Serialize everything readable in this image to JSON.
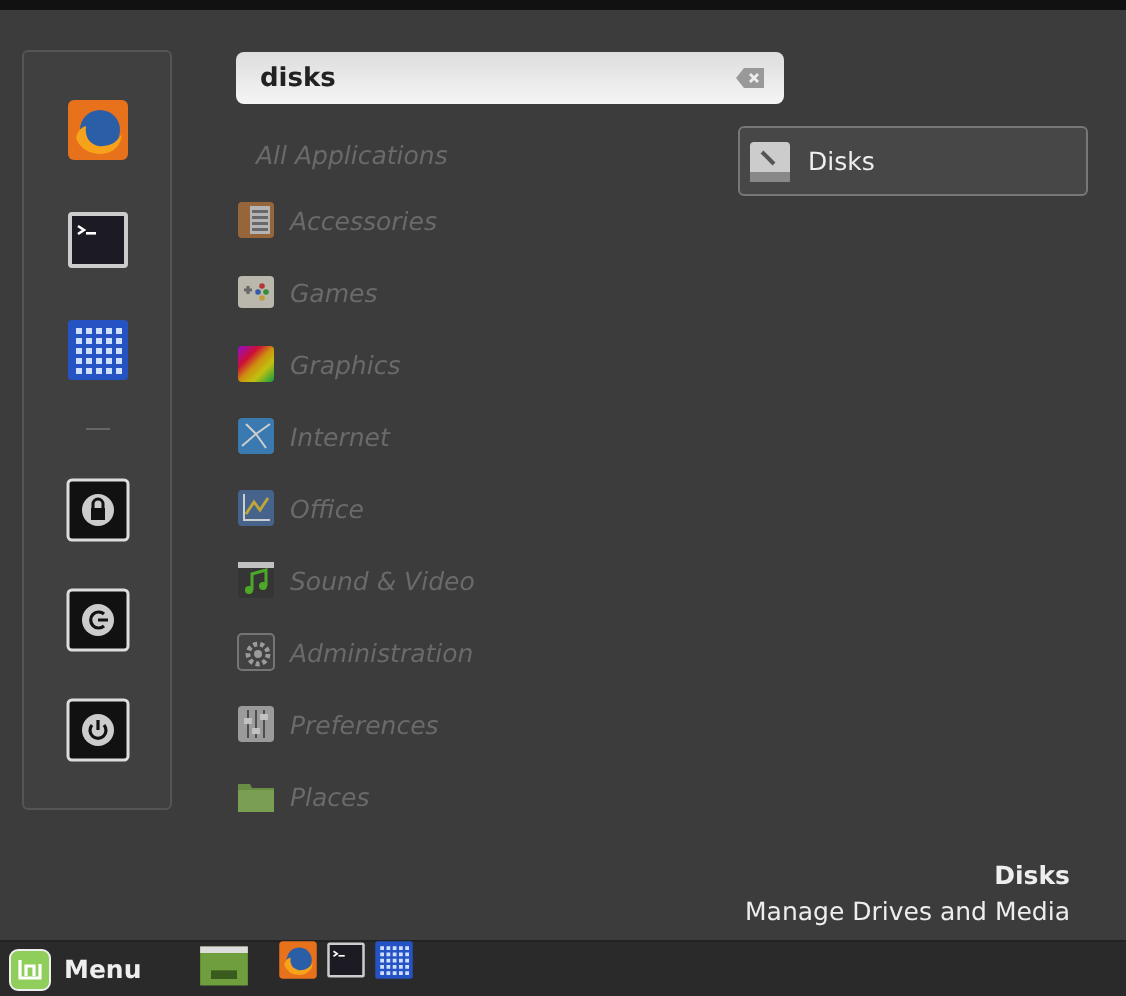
{
  "favorites": [
    {
      "kind": "firefox"
    },
    {
      "kind": "terminal"
    },
    {
      "kind": "grid"
    },
    {
      "kind": "separator"
    },
    {
      "kind": "lock"
    },
    {
      "kind": "logout"
    },
    {
      "kind": "power"
    }
  ],
  "search": {
    "value": "disks"
  },
  "categories": [
    {
      "label": "All Applications",
      "kind": "none",
      "disabled": true
    },
    {
      "label": "Accessories",
      "kind": "accessories",
      "disabled": true
    },
    {
      "label": "Games",
      "kind": "games",
      "disabled": true
    },
    {
      "label": "Graphics",
      "kind": "graphics",
      "disabled": true
    },
    {
      "label": "Internet",
      "kind": "internet",
      "disabled": true
    },
    {
      "label": "Office",
      "kind": "office",
      "disabled": true
    },
    {
      "label": "Sound & Video",
      "kind": "sound",
      "disabled": true
    },
    {
      "label": "Administration",
      "kind": "admin",
      "disabled": true
    },
    {
      "label": "Preferences",
      "kind": "prefs",
      "disabled": true
    },
    {
      "label": "Places",
      "kind": "places",
      "disabled": true
    }
  ],
  "results": [
    {
      "label": "Disks",
      "selected": true
    }
  ],
  "description": {
    "title": "Disks",
    "text": "Manage Drives and Media"
  },
  "taskbar": {
    "menu_label": "Menu",
    "launchers": [
      {
        "kind": "files"
      },
      {
        "kind": "firefox"
      },
      {
        "kind": "terminal"
      },
      {
        "kind": "grid"
      }
    ]
  }
}
